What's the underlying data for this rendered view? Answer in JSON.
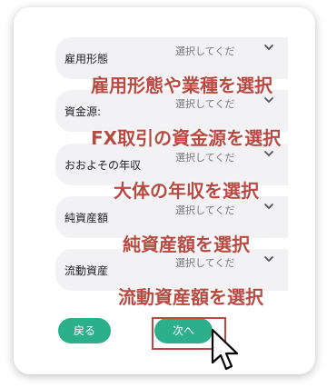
{
  "form": {
    "rows": [
      {
        "label": "雇用形態",
        "placeholder": "選択してくだ",
        "annotation": "雇用形態や業種を選択"
      },
      {
        "label": "資金源:",
        "placeholder": "選択してくだ",
        "annotation": "FX取引の資金源を選択"
      },
      {
        "label": "おおよその年収",
        "placeholder": "選択してくだ",
        "annotation": "大体の年収を選択"
      },
      {
        "label": "純資産額",
        "placeholder": "選択してくだ",
        "annotation": "純資産額を選択"
      },
      {
        "label": "流動資産",
        "placeholder": "選択してくだ",
        "annotation": "流動資産額を選択"
      }
    ]
  },
  "buttons": {
    "back_label": "戻る",
    "next_label": "次へ"
  },
  "colors": {
    "accent_green": "#2bb08a",
    "annotation_red": "#b94a43"
  },
  "icons": {
    "chevron": "chevron-down-icon",
    "pointer": "mouse-pointer-icon"
  }
}
